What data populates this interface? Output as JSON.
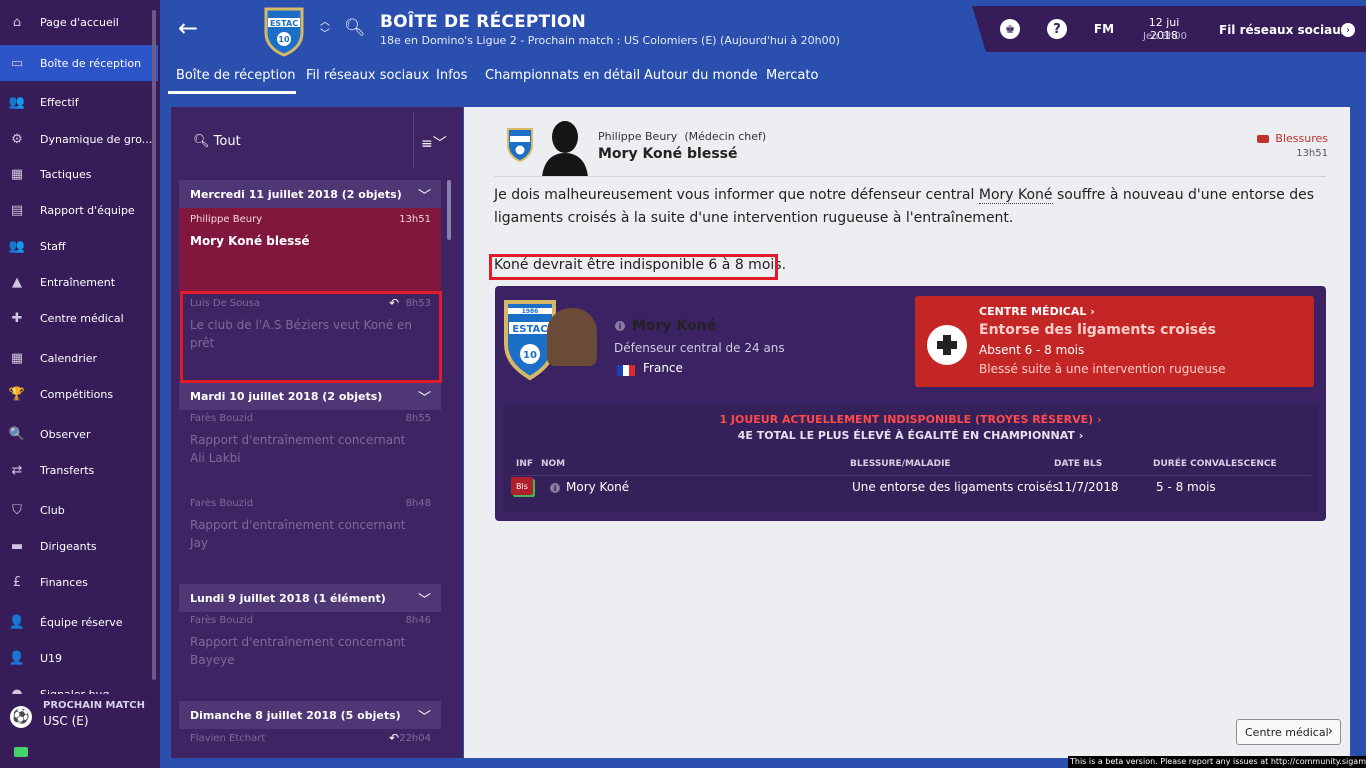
{
  "sidebar": {
    "items": [
      {
        "label": "Page d'accueil",
        "icon": "home-icon",
        "glyph": "⌂"
      },
      {
        "label": "Boîte de réception",
        "icon": "inbox-icon",
        "glyph": "▭"
      },
      {
        "label": "Effectif",
        "icon": "squad-icon",
        "glyph": "👥"
      },
      {
        "label": "Dynamique de gro...",
        "icon": "dynamics-icon",
        "glyph": "⚙"
      },
      {
        "label": "Tactiques",
        "icon": "tactics-icon",
        "glyph": "▦"
      },
      {
        "label": "Rapport d'équipe",
        "icon": "report-icon",
        "glyph": "▤"
      },
      {
        "label": "Staff",
        "icon": "staff-icon",
        "glyph": "👥"
      },
      {
        "label": "Entraînement",
        "icon": "training-icon",
        "glyph": "▲"
      },
      {
        "label": "Centre médical",
        "icon": "medical-icon",
        "glyph": "✚"
      },
      {
        "label": "Calendrier",
        "icon": "calendar-icon",
        "glyph": "▦"
      },
      {
        "label": "Compétitions",
        "icon": "trophy-icon",
        "glyph": "🏆"
      },
      {
        "label": "Observer",
        "icon": "scout-icon",
        "glyph": "🔍"
      },
      {
        "label": "Transferts",
        "icon": "transfers-icon",
        "glyph": "⇄"
      },
      {
        "label": "Club",
        "icon": "club-icon",
        "glyph": "⛉"
      },
      {
        "label": "Dirigeants",
        "icon": "board-icon",
        "glyph": "▬"
      },
      {
        "label": "Finances",
        "icon": "finances-icon",
        "glyph": "£"
      },
      {
        "label": "Équipe réserve",
        "icon": "reserve-icon",
        "glyph": "👤"
      },
      {
        "label": "U19",
        "icon": "u19-icon",
        "glyph": "👤"
      },
      {
        "label": "Signaler bug",
        "icon": "bug-icon",
        "glyph": "●"
      }
    ],
    "next_match": {
      "label": "PROCHAIN MATCH",
      "opponent": "USC (E)"
    }
  },
  "header": {
    "title": "BOÎTE DE RÉCEPTION",
    "subtitle": "18e en Domino's Ligue 2 - Prochain match : US Colomiers (E) (Aujourd'hui à 20h00)",
    "crest_text": "ESTAC",
    "crest_number": "10",
    "date": "12 jui 2018",
    "time": "Jeu 8h00",
    "fm_label": "FM",
    "help_label": "?",
    "social_label": "Fil réseaux sociaux"
  },
  "tabs": [
    "Boîte de réception",
    "Fil réseaux sociaux",
    "Infos",
    "Championnats en détail",
    "Autour du monde",
    "Mercato"
  ],
  "list": {
    "filter_label": "Tout",
    "groups": [
      {
        "label": "Mercredi 11 juillet 2018 (2 objets)"
      },
      {
        "label": "Mardi 10 juillet 2018 (2 objets)"
      },
      {
        "label": "Lundi 9 juillet 2018 (1 élément)"
      },
      {
        "label": "Dimanche 8 juillet 2018 (5 objets)"
      }
    ],
    "messages": [
      {
        "from": "Philippe Beury",
        "time": "13h51",
        "subject": "Mory Koné blessé"
      },
      {
        "from": "Luis De Sousa",
        "time": "8h53",
        "subject": "Le club de l'A.S Béziers veut Koné en prêt"
      },
      {
        "from": "Farès Bouzid",
        "time": "8h55",
        "subject": "Rapport d'entraînement concernant Ali Lakbi"
      },
      {
        "from": "Farès Bouzid",
        "time": "8h48",
        "subject": "Rapport d'entraînement concernant Jay"
      },
      {
        "from": "Farès Bouzid",
        "time": "8h46",
        "subject": "Rapport d'entraînement concernant Bayeye"
      },
      {
        "from": "Flavien Etchart",
        "time": "22h04",
        "subject": ""
      }
    ]
  },
  "message": {
    "sender_name": "Philippe Beury",
    "sender_role": "(Médecin chef)",
    "subject": "Mory Koné blessé",
    "tag": "Blessures",
    "time": "13h51",
    "body_before": "Je dois malheureusement vous informer que notre défenseur central ",
    "body_player": "Mory Koné",
    "body_after": " souffre à nouveau d'une entorse des ligaments croisés à la suite d'une intervention rugueuse à l'entraînement.",
    "body2": "Koné devrait être indisponible 6 à 8 mois."
  },
  "card": {
    "crest_year": "1986",
    "player_name": "Mory Koné",
    "player_role": "Défenseur central de 24 ans",
    "nationality": "France",
    "medical": {
      "title": "CENTRE MÉDICAL",
      "injury": "Entorse des ligaments croisés",
      "absence": "Absent 6 - 8 mois",
      "cause": "Blessé suite à une intervention rugueuse"
    },
    "summary1": "1 JOUEUR ACTUELLEMENT INDISPONIBLE (TROYES RÉSERVE)",
    "summary2": "4E TOTAL LE PLUS ÉLEVÉ À ÉGALITÉ EN CHAMPIONNAT",
    "columns": [
      "INF",
      "NOM",
      "BLESSURE/MALADIE",
      "DATE BLS",
      "DURÉE CONVALESCENCE"
    ],
    "row": {
      "badge": "Bls",
      "name": "Mory Koné",
      "injury": "Une entorse des ligaments croisés",
      "date": "11/7/2018",
      "duration": "5 - 8 mois"
    }
  },
  "button_medical": "Centre médical",
  "beta_notice": "This is a beta version. Please report any issues at http://community.sigames.com",
  "colors": {
    "accent": "#2d55c8",
    "sidebar": "#361c58",
    "selected": "#82173e",
    "medical": "#c42525",
    "highlight": "#e01c2b"
  }
}
